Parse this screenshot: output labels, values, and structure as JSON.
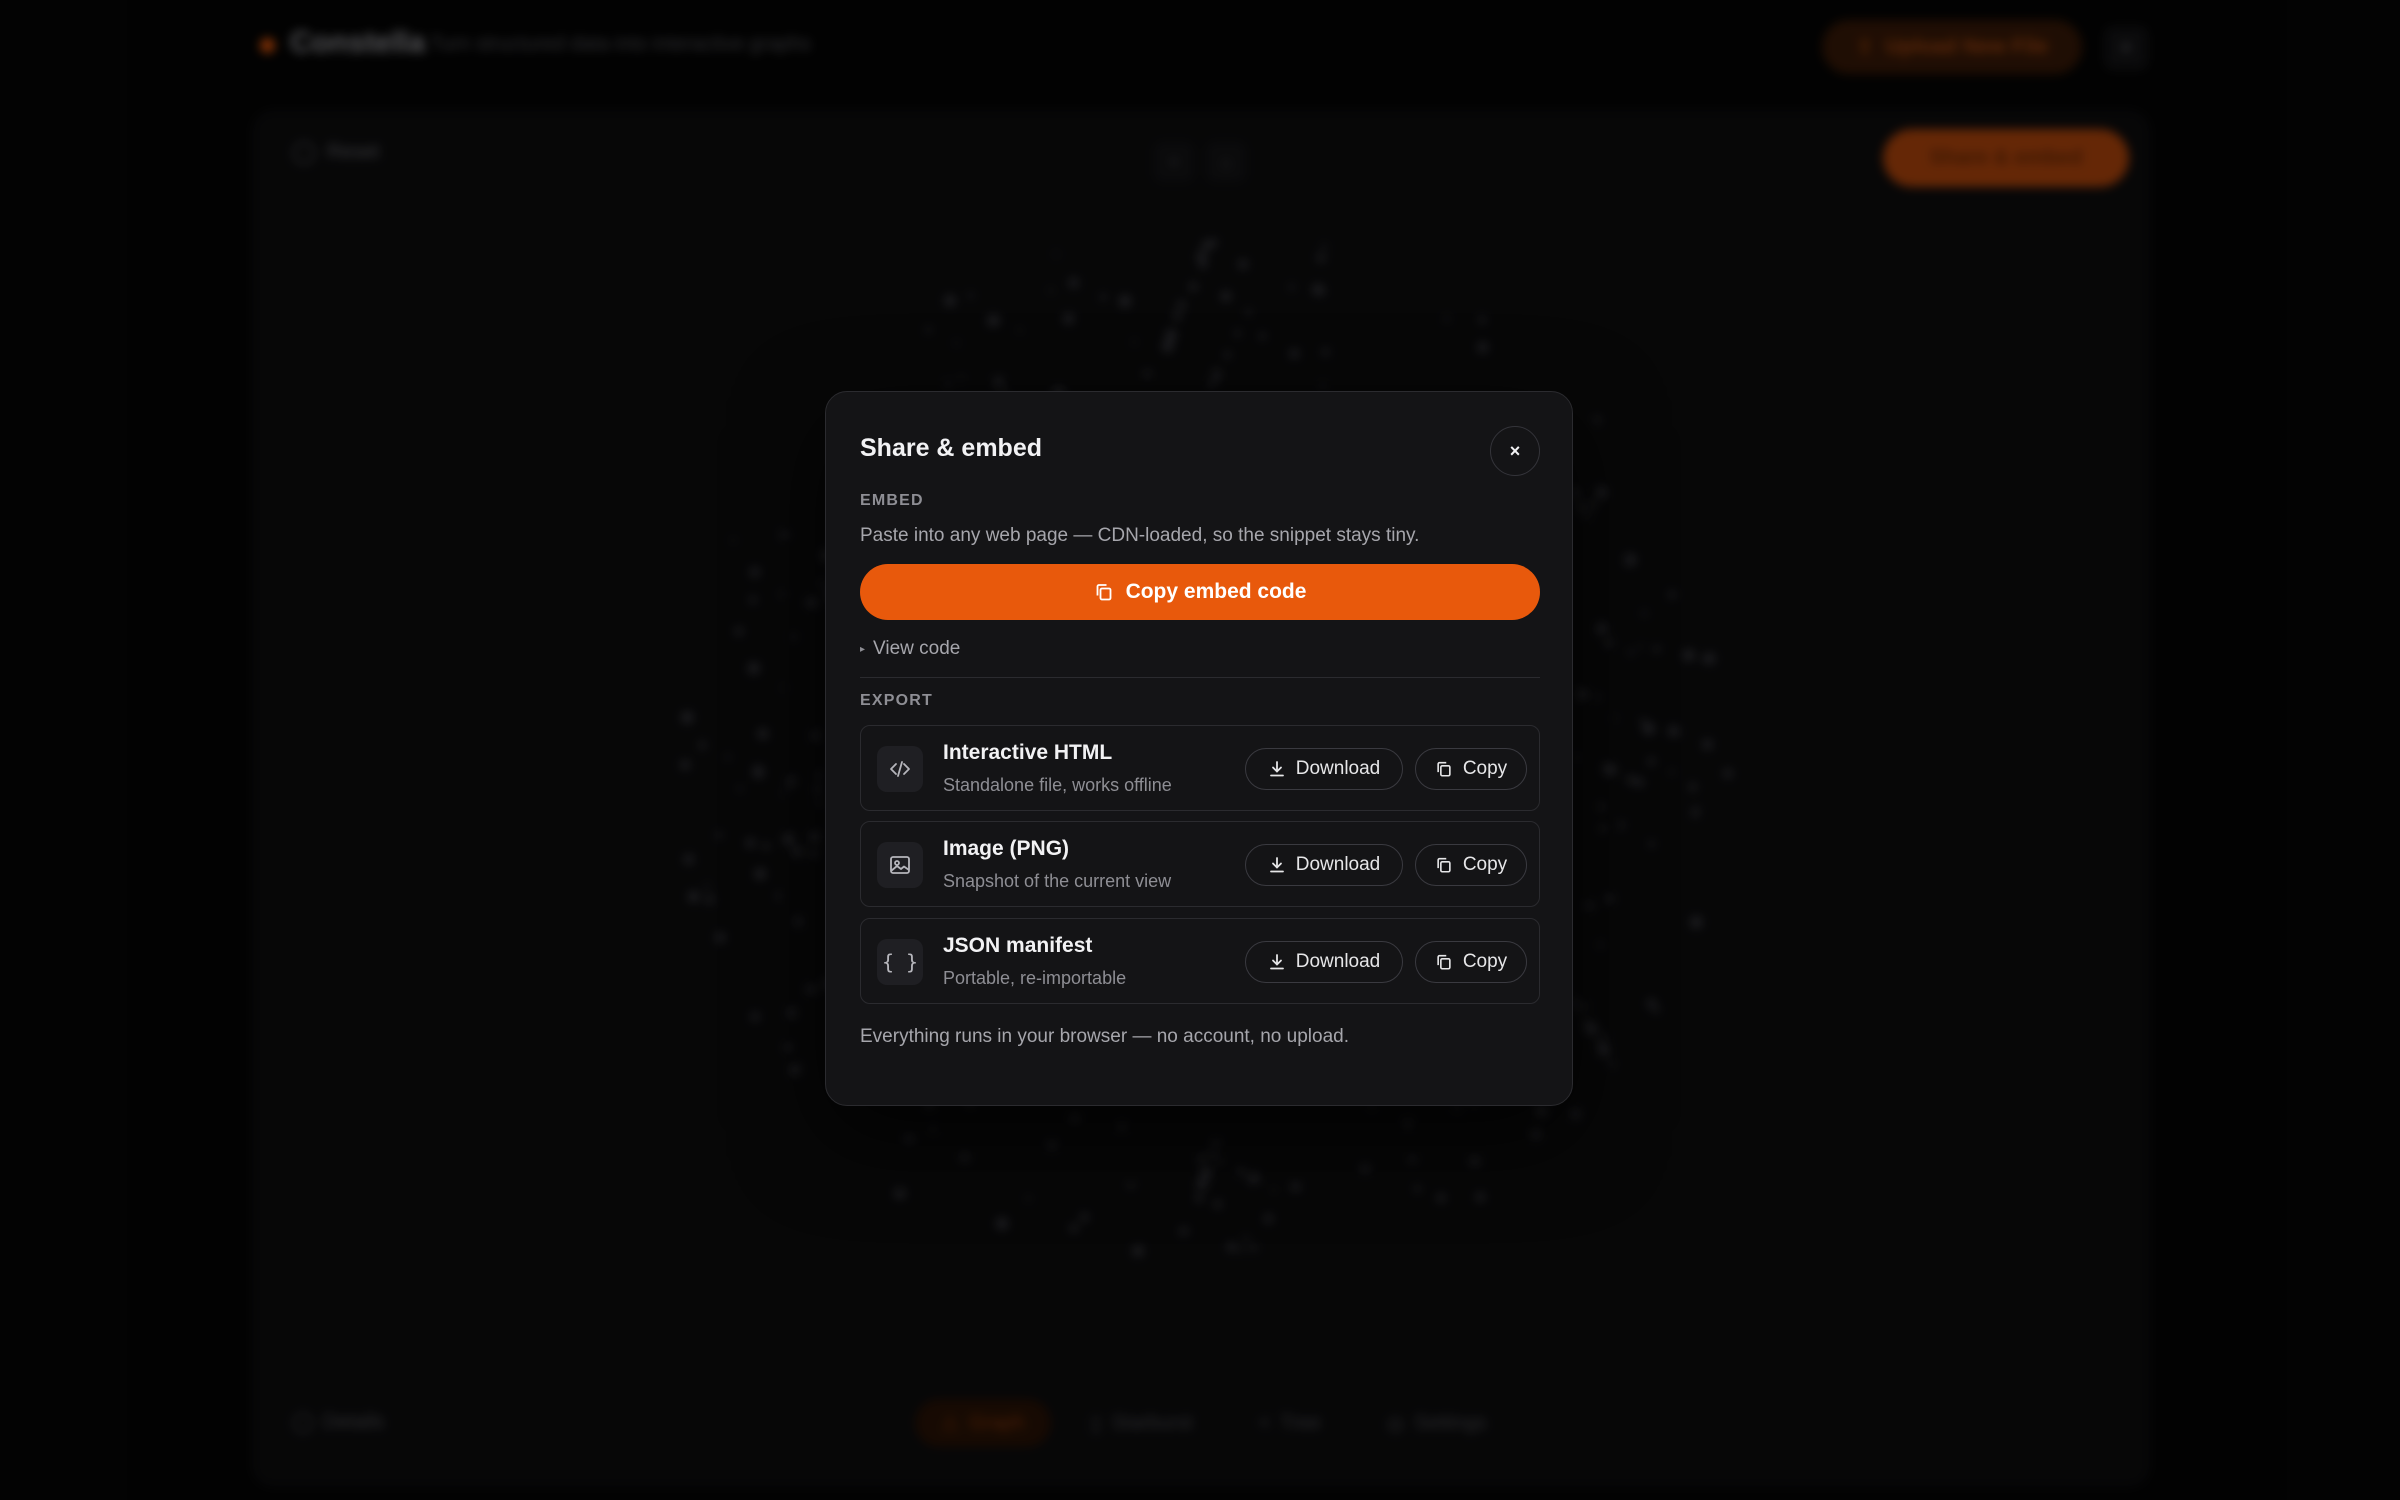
{
  "app": {
    "brand_name": "Constella",
    "tagline": "Turn structured data into interactive graphs",
    "upload_label": "Upload New File",
    "reset_label": "Reset",
    "share_label": "Share & embed",
    "details_label": "Details",
    "bottom_tabs": [
      {
        "label": "Graph",
        "active": true
      },
      {
        "label": "Starburst",
        "active": false
      },
      {
        "label": "Tree",
        "active": false
      },
      {
        "label": "Settings",
        "active": false
      }
    ]
  },
  "modal": {
    "title": "Share & embed",
    "close_glyph": "×",
    "embed": {
      "section_label": "EMBED",
      "description": "Paste into any web page — CDN-loaded, so the snippet stays tiny.",
      "copy_button": "Copy embed code",
      "view_code": "View code"
    },
    "export": {
      "section_label": "EXPORT",
      "rows": [
        {
          "icon": "code-icon",
          "title": "Interactive HTML",
          "subtitle": "Standalone file, works offline",
          "download": "Download",
          "copy": "Copy"
        },
        {
          "icon": "image-icon",
          "title": "Image (PNG)",
          "subtitle": "Snapshot of the current view",
          "download": "Download",
          "copy": "Copy"
        },
        {
          "icon": "braces-icon",
          "title": "JSON manifest",
          "subtitle": "Portable, re-importable",
          "download": "Download",
          "copy": "Copy"
        }
      ]
    },
    "footer_note": "Everything runs in your browser — no account, no upload."
  },
  "colors": {
    "accent": "#e8590c",
    "modal_bg": "#141416",
    "border": "#2b2b2f",
    "page_bg": "#050505"
  }
}
